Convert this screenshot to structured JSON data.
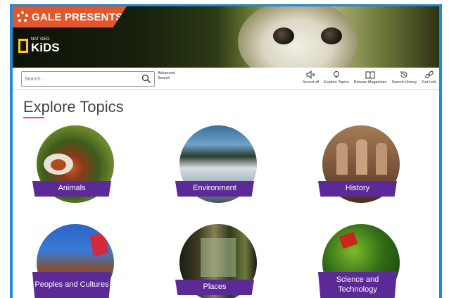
{
  "banner": {
    "brand": "GALE PRESENTS",
    "natgeo_small": "NAT GEO",
    "natgeo_kids": "KiDS"
  },
  "toolbar": {
    "search_placeholder": "Search...",
    "advanced_search": "Advanced Search",
    "tools": [
      {
        "label": "Sound off",
        "icon": "sound-off-icon"
      },
      {
        "label": "Explore Topics",
        "icon": "lightbulb-icon"
      },
      {
        "label": "Browse Magazines",
        "icon": "book-icon"
      },
      {
        "label": "Search History",
        "icon": "history-icon"
      },
      {
        "label": "Get Link",
        "icon": "link-icon"
      }
    ]
  },
  "page": {
    "title": "Explore Topics"
  },
  "topics": [
    {
      "label": "Animals"
    },
    {
      "label": "Environment"
    },
    {
      "label": "History"
    },
    {
      "label": "Peoples and Cultures"
    },
    {
      "label": "Places"
    },
    {
      "label": "Science and Technology"
    }
  ],
  "colors": {
    "accent": "#e4562b",
    "label_bg": "#5b2a97",
    "border": "#1f8bd6"
  }
}
